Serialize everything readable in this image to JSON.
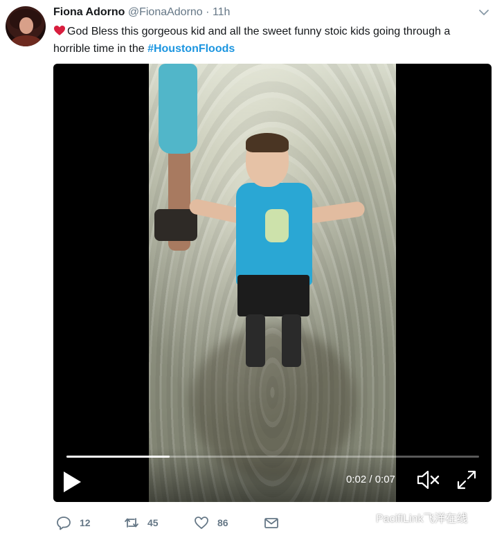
{
  "tweet": {
    "author_name": "Fiona Adorno",
    "handle": "@FionaAdorno",
    "separator": "·",
    "time": "11h",
    "text_before": "God Bless this gorgeous kid and all the sweet funny stoic kids going through a horrible time in the ",
    "hashtag": "#HoustonFloods"
  },
  "video": {
    "time_display": "0:02 / 0:07",
    "progress": 0.25
  },
  "actions": {
    "reply_count": "12",
    "retweet_count": "45",
    "like_count": "86"
  },
  "watermark": {
    "text": "PacifiLink飞洋在线"
  },
  "colors": {
    "link": "#1b95e0",
    "muted": "#657786",
    "heart": "#d81e3e"
  },
  "icons": [
    "heart-emoji-icon",
    "chevron-down-icon",
    "play-icon",
    "volume-muted-icon",
    "fullscreen-icon",
    "reply-icon",
    "retweet-icon",
    "like-icon",
    "message-icon",
    "wechat-icon"
  ]
}
